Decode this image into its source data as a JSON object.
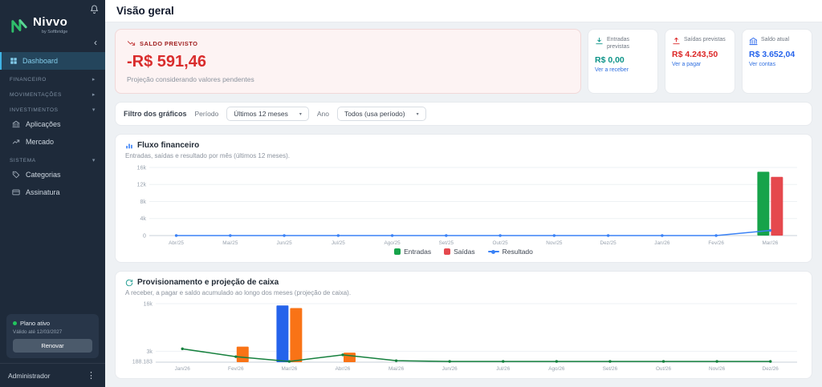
{
  "icons": {
    "collapse": "‹",
    "section_collapsed": "▸",
    "section_expanded": "▾",
    "select_caret": "▾",
    "kebab": "⋮"
  },
  "sidebar": {
    "logo": {
      "name": "Nivvo",
      "byline": "by Softbridge"
    },
    "dashboard_label": "Dashboard",
    "sections": [
      {
        "label": "FINANCEIRO",
        "expanded": false,
        "items": []
      },
      {
        "label": "MOVIMENTAÇÕES",
        "expanded": false,
        "items": []
      },
      {
        "label": "INVESTIMENTOS",
        "expanded": true,
        "items": [
          "Aplicações",
          "Mercado"
        ]
      },
      {
        "label": "SISTEMA",
        "expanded": true,
        "items": [
          "Categorias",
          "Assinatura"
        ]
      }
    ],
    "plan": {
      "status": "Plano ativo",
      "validity": "Válido até 12/03/2027",
      "renew": "Renovar"
    },
    "user": "Administrador"
  },
  "header": {
    "title": "Visão geral"
  },
  "summary": {
    "forecast": {
      "label": "SALDO PREVISTO",
      "value": "-R$ 591,46",
      "note": "Projeção considerando valores pendentes",
      "color": "#d92c2c"
    },
    "cards": [
      {
        "label": "Entradas previstas",
        "value": "R$ 0,00",
        "link": "Ver a receber",
        "color": "#0d9488"
      },
      {
        "label": "Saídas previstas",
        "value": "R$ 4.243,50",
        "link": "Ver a pagar",
        "color": "#dc2626"
      },
      {
        "label": "Saldo atual",
        "value": "R$ 3.652,04",
        "link": "Ver contas",
        "color": "#2563eb"
      }
    ]
  },
  "filters": {
    "title": "Filtro dos gráficos",
    "period_label": "Período",
    "period_value": "Últimos 12 meses",
    "year_label": "Ano",
    "year_value": "Todos (usa período)"
  },
  "chart_data": [
    {
      "type": "bar",
      "title": "Fluxo financeiro",
      "subtitle": "Entradas, saídas e resultado por mês (últimos 12 meses).",
      "categories": [
        "Abr/25",
        "Mai/25",
        "Jun/25",
        "Jul/25",
        "Ago/25",
        "Set/25",
        "Out/25",
        "Nov/25",
        "Dez/25",
        "Jan/26",
        "Fev/26",
        "Mar/26"
      ],
      "series": [
        {
          "name": "Entradas",
          "kind": "bar",
          "color": "#16a34a",
          "values": [
            0,
            0,
            0,
            0,
            0,
            0,
            0,
            0,
            0,
            0,
            0,
            15000
          ]
        },
        {
          "name": "Saídas",
          "kind": "bar",
          "color": "#e5484d",
          "values": [
            0,
            0,
            0,
            0,
            0,
            0,
            0,
            0,
            0,
            0,
            0,
            13800
          ]
        },
        {
          "name": "Resultado",
          "kind": "line",
          "color": "#3b82f6",
          "values": [
            0,
            0,
            0,
            0,
            0,
            0,
            0,
            0,
            0,
            0,
            0,
            1200
          ]
        }
      ],
      "ylim": [
        0,
        16000
      ],
      "yticks": [
        {
          "label": "16k",
          "value": 16000
        },
        {
          "label": "12k",
          "value": 12000
        },
        {
          "label": "8k",
          "value": 8000
        },
        {
          "label": "4k",
          "value": 4000
        },
        {
          "label": "0",
          "value": 0
        }
      ],
      "grid": true,
      "legend_position": "bottom"
    },
    {
      "type": "bar",
      "title": "Provisionamento e projeção de caixa",
      "subtitle": "A receber, a pagar e saldo acumulado ao longo dos meses (projeção de caixa).",
      "categories": [
        "Jan/26",
        "Fev/26",
        "Mar/26",
        "Abr/26",
        "Mai/26",
        "Jun/26",
        "Jul/26",
        "Ago/26",
        "Set/26",
        "Out/26",
        "Nov/26",
        "Dez/26"
      ],
      "series": [
        {
          "name": "A receber",
          "kind": "bar",
          "color": "#2563eb",
          "values": [
            0,
            0,
            15500,
            0,
            0,
            0,
            0,
            0,
            0,
            0,
            0,
            0
          ]
        },
        {
          "name": "A pagar",
          "kind": "bar",
          "color": "#f97316",
          "values": [
            0,
            4243.5,
            14800,
            2600,
            0,
            0,
            0,
            0,
            0,
            0,
            0,
            0
          ]
        },
        {
          "name": "Saldo acumulado",
          "kind": "line",
          "color": "#15803d",
          "values": [
            3652,
            1500,
            200,
            2000,
            400,
            200,
            200,
            200,
            200,
            200,
            200,
            200
          ]
        }
      ],
      "ylim": [
        0,
        16000
      ],
      "yticks": [
        {
          "label": "16k",
          "value": 16000
        },
        {
          "label": "3k",
          "value": 3000
        },
        {
          "label": "188.183",
          "value": 188
        }
      ],
      "grid": true,
      "legend_position": "none"
    }
  ]
}
